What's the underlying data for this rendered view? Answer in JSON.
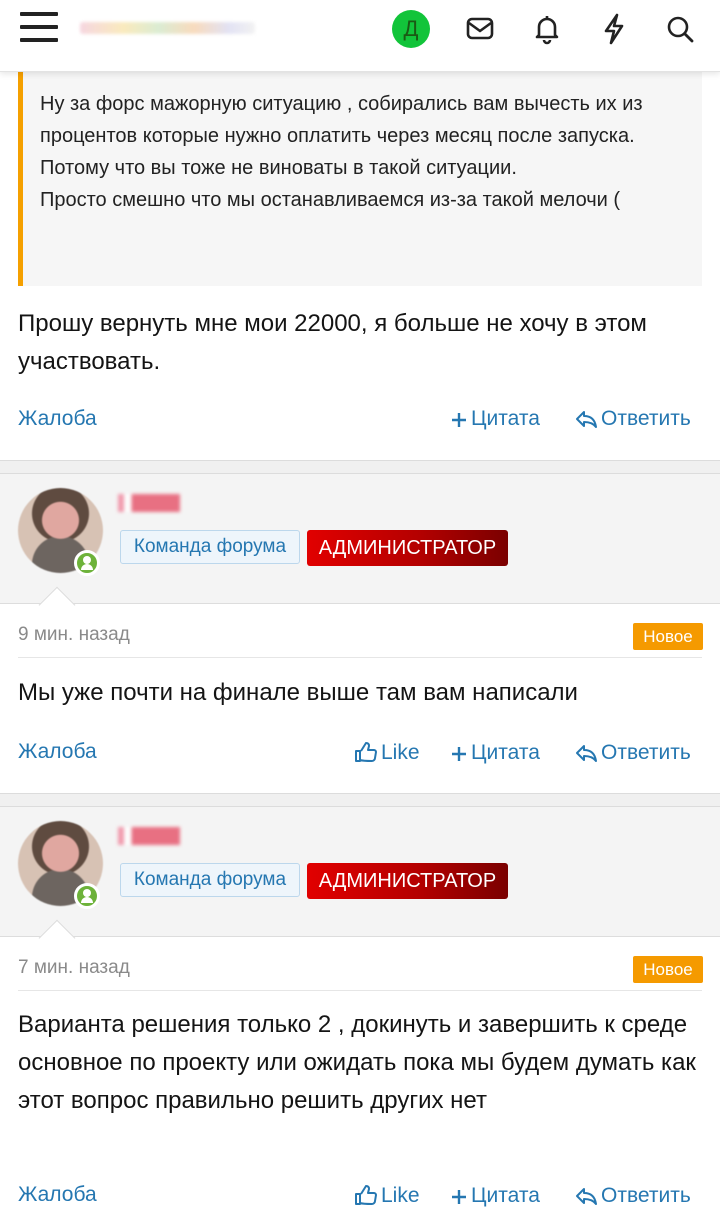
{
  "header": {
    "user_initial": "Д",
    "icons": [
      "menu-icon",
      "mail-icon",
      "bell-icon",
      "lightning-icon",
      "search-icon"
    ]
  },
  "quote": {
    "text": "Ну за форс мажорную ситуацию , собирались вам вычесть их из процентов которые нужно оплатить через месяц после запуска. Потому что вы тоже не виноваты в такой ситуации.\nПросто смешно что мы останавливаемся из-за такой мелочи ("
  },
  "post1": {
    "text": "Прошу вернуть мне мои 22000, я больше не хочу в этом участвовать.",
    "actions": {
      "report": "Жалоба",
      "quote": "Цитата",
      "reply": "Ответить"
    }
  },
  "post2": {
    "team_badge": "Команда форума",
    "role_badge": "АДМИНИСТРАТОР",
    "time": "9 мин. назад",
    "new_label": "Новое",
    "text": "Мы уже почти на финале выше там вам написали",
    "actions": {
      "report": "Жалоба",
      "like": "Like",
      "quote": "Цитата",
      "reply": "Ответить"
    }
  },
  "post3": {
    "team_badge": "Команда форума",
    "role_badge": "АДМИНИСТРАТОР",
    "time": "7 мин. назад",
    "new_label": "Новое",
    "text": "Варианта решения только 2 , докинуть и завершить к среде основное по проекту или ожидать пока мы будем думать как этот вопрос правильно решить других нет",
    "actions": {
      "report": "Жалоба",
      "like": "Like",
      "quote": "Цитата",
      "reply": "Ответить"
    }
  },
  "colors": {
    "accent": "#2577b1",
    "online": "#6db23a",
    "new_badge": "#f59a00",
    "admin_badge": "#e10000",
    "quote_border": "#f5a000"
  }
}
